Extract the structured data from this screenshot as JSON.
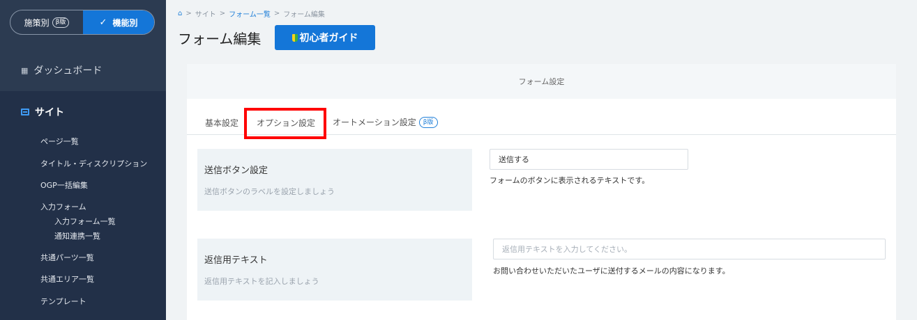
{
  "sidebar": {
    "toggle": {
      "left_label": "施策別",
      "left_badge": "β版",
      "right_label": "機能別"
    },
    "dashboard_label": "ダッシュボード",
    "site_label": "サイト",
    "items": [
      {
        "label": "ページ一覧"
      },
      {
        "label": "タイトル・ディスクリプション"
      },
      {
        "label": "OGP一括編集"
      },
      {
        "label": "入力フォーム"
      },
      {
        "label": "入力フォーム一覧"
      },
      {
        "label": "通知連携一覧"
      },
      {
        "label": "共通パーツ一覧"
      },
      {
        "label": "共通エリア一覧"
      },
      {
        "label": "テンプレート"
      }
    ]
  },
  "breadcrumb": {
    "sep": ">",
    "items": [
      "サイト",
      "フォーム一覧",
      "フォーム編集"
    ]
  },
  "page": {
    "title": "フォーム編集",
    "guide_label": "初心者ガイド"
  },
  "card": {
    "header": "フォーム設定",
    "tabs": [
      {
        "label": "基本設定"
      },
      {
        "label": "オプション設定"
      },
      {
        "label": "オートメーション設定",
        "badge": "β版"
      }
    ]
  },
  "settings": [
    {
      "title": "送信ボタン設定",
      "description": "送信ボタンのラベルを設定しましょう",
      "value": "送信する",
      "placeholder": "",
      "help": "フォームのボタンに表示されるテキストです。"
    },
    {
      "title": "返信用テキスト",
      "description": "返信用テキストを記入しましょう",
      "value": "",
      "placeholder": "返信用テキストを入力してください。",
      "help": "お問い合わせいただいたユーザに送付するメールの内容になります。"
    }
  ],
  "colors": {
    "sidebar_bg": "#2c3b51",
    "accent": "#1476d8",
    "highlight": "#ff0000"
  }
}
